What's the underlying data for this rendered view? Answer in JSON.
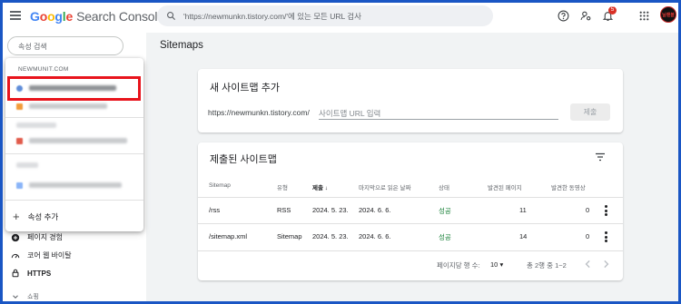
{
  "header": {
    "logo_google": [
      "G",
      "o",
      "o",
      "g",
      "l",
      "e"
    ],
    "product": "Search Console",
    "search_placeholder": "'https://newmunkn.tistory.com/'에 있는 모든 URL 검사",
    "notification_count": "5",
    "avatar_text": "닐랜블"
  },
  "sidebar": {
    "property_search_placeholder": "속성 검색",
    "dropdown": {
      "section_label": "NEWMUNIT.COM",
      "add_property": "속성 추가"
    },
    "nav_items": [
      {
        "label": "페이지 경험",
        "icon": "plus-circle-icon"
      },
      {
        "label": "코어 웹 바이탈",
        "icon": "speedometer-icon"
      },
      {
        "label": "HTTPS",
        "icon": "lock-icon"
      },
      {
        "label": "쇼핑",
        "icon": "chevron-down-icon"
      }
    ]
  },
  "main": {
    "page_title": "Sitemaps",
    "add_sitemap": {
      "title": "새 사이트맵 추가",
      "url_prefix": "https://newmunkn.tistory.com/",
      "input_placeholder": "사이트맵 URL 입력",
      "submit_label": "제출"
    },
    "submitted": {
      "title": "제출된 사이트맵",
      "columns": [
        "Sitemap",
        "유형",
        "제출",
        "마지막으로 읽은 날짜",
        "상태",
        "발견된 페이지",
        "발견한 동영상"
      ],
      "sort_arrow": "↓",
      "rows": [
        {
          "sitemap": "/rss",
          "type": "RSS",
          "submitted": "2024. 5. 23.",
          "last_read": "2024. 6. 6.",
          "status": "성공",
          "pages": "11",
          "videos": "0"
        },
        {
          "sitemap": "/sitemap.xml",
          "type": "Sitemap",
          "submitted": "2024. 5. 23.",
          "last_read": "2024. 6. 6.",
          "status": "성공",
          "pages": "14",
          "videos": "0"
        }
      ],
      "footer": {
        "rows_per_page_label": "페이지당 행 수:",
        "rows_per_page_value": "10",
        "range": "총 2행 중 1~2"
      }
    }
  },
  "colors": {
    "brand_blue": "#4285f4",
    "success_green": "#188038",
    "highlight_red": "#e8141c",
    "frame_blue": "#1a56c4"
  }
}
